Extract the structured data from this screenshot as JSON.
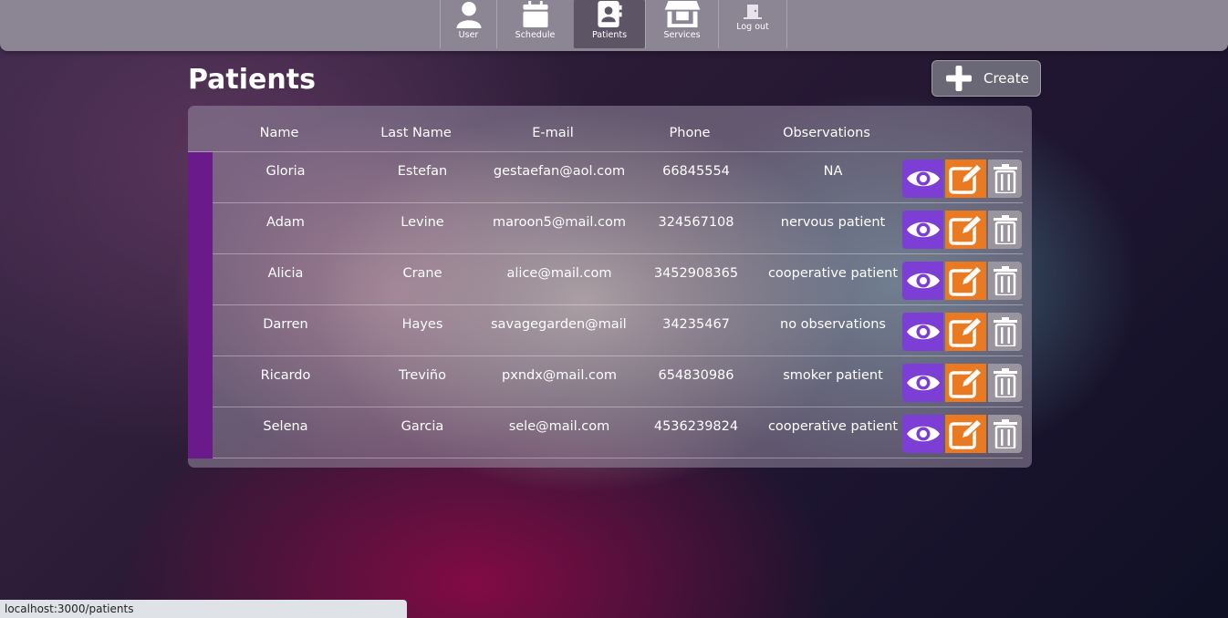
{
  "nav": {
    "items": [
      {
        "label": "User",
        "icon": "user-icon"
      },
      {
        "label": "Schedule",
        "icon": "calendar-icon"
      },
      {
        "label": "Patients",
        "icon": "contact-book-icon",
        "active": true
      },
      {
        "label": "Services",
        "icon": "store-icon"
      },
      {
        "label": "Log out",
        "icon": "door-icon"
      }
    ]
  },
  "page": {
    "title": "Patients",
    "create_label": "Create"
  },
  "table": {
    "headers": [
      "Name",
      "Last Name",
      "E-mail",
      "Phone",
      "Observations"
    ],
    "rows": [
      {
        "name": "Gloria",
        "last_name": "Estefan",
        "email": "gestaefan@aol.com",
        "phone": "66845554",
        "observations": "NA"
      },
      {
        "name": "Adam",
        "last_name": "Levine",
        "email": "maroon5@mail.com",
        "phone": "324567108",
        "observations": "nervous patient"
      },
      {
        "name": "Alicia",
        "last_name": "Crane",
        "email": "alice@mail.com",
        "phone": "3452908365",
        "observations": "cooperative patient"
      },
      {
        "name": "Darren",
        "last_name": "Hayes",
        "email": "savagegarden@mail.com",
        "phone": "34235467",
        "observations": "no observations"
      },
      {
        "name": "Ricardo",
        "last_name": "Treviño",
        "email": "pxndx@mail.com",
        "phone": "654830986",
        "observations": "smoker patient"
      },
      {
        "name": "Selena",
        "last_name": "Garcia",
        "email": "sele@mail.com",
        "phone": "4536239824",
        "observations": "cooperative patient"
      }
    ]
  },
  "colors": {
    "row_marker": "#6a1a8a",
    "view": "#7d3ed6",
    "edit": "#e97a22",
    "delete": "#9a949e"
  },
  "status": {
    "url": "localhost:3000/patients"
  }
}
